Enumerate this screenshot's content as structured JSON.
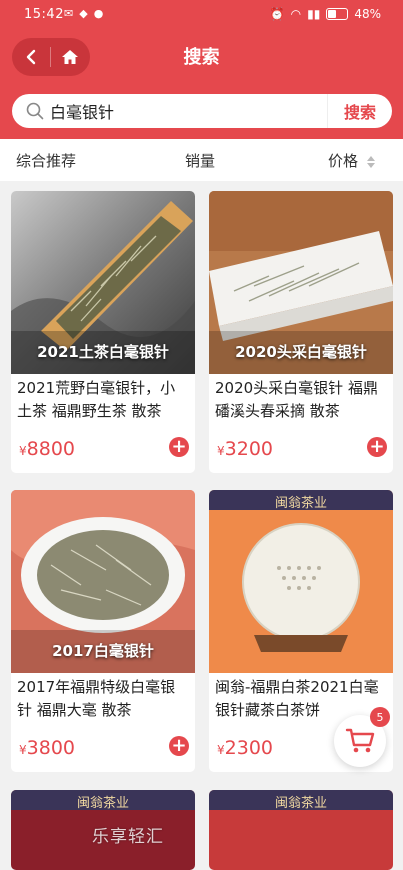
{
  "status_bar": {
    "time": "15:42",
    "battery": "48%",
    "battery_level": 0.48
  },
  "header": {
    "title": "搜索"
  },
  "search": {
    "query": "白毫银针",
    "button_label": "搜索"
  },
  "sort": {
    "items": [
      "综合推荐",
      "销量",
      "价格"
    ]
  },
  "products": [
    {
      "title": "2021荒野白毫银针，小土茶 福鼎野生茶 散茶",
      "caption": "2021土茶白毫银针",
      "currency": "¥",
      "price": "8800"
    },
    {
      "title": "2020头采白毫银针 福鼎磻溪头春采摘 散茶",
      "caption": "2020头采白毫银针",
      "currency": "¥",
      "price": "3200"
    },
    {
      "title": "2017年福鼎特级白毫银针 福鼎大毫 散茶",
      "caption": "2017白毫银针",
      "currency": "¥",
      "price": "3800"
    },
    {
      "title": "闽翁-福鼎白茶2021白毫银针藏茶白茶饼",
      "caption": "",
      "brand": "闽翁茶业",
      "currency": "¥",
      "price": "2300"
    },
    {
      "brand": "闽翁茶业"
    },
    {
      "brand": "闽翁茶业"
    }
  ],
  "cart": {
    "count": "5"
  },
  "watermark": "乐享轻汇"
}
